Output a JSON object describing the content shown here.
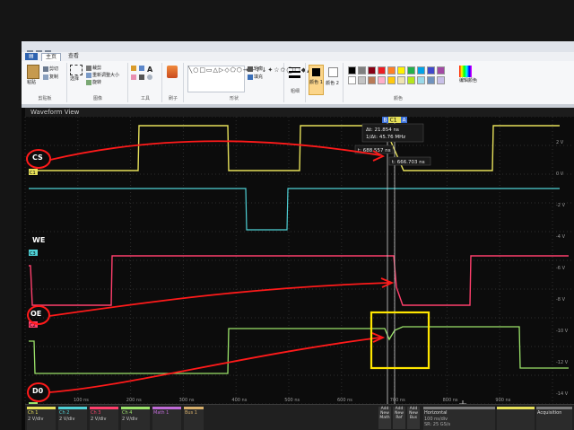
{
  "paint": {
    "tabs": [
      "主页",
      "查看"
    ],
    "clipboard": {
      "paste": "粘贴",
      "cut": "剪切",
      "copy": "复制",
      "label": "剪贴板"
    },
    "image": {
      "crop": "裁剪",
      "resize": "重新调整大小",
      "rotate": "旋转",
      "select": "选择",
      "label": "图像"
    },
    "tools": {
      "label": "工具"
    },
    "brushes": {
      "label": "刷子"
    },
    "shapes": {
      "outline": "轮廓",
      "fill": "填充",
      "label": "形状"
    },
    "size": {
      "label": "粗细"
    },
    "color1": {
      "label": "颜色 1"
    },
    "color2": {
      "label": "颜色 2"
    },
    "colors": {
      "label": "颜色",
      "edit": "编辑颜色"
    },
    "palette": [
      "#000000",
      "#7f7f7f",
      "#880015",
      "#ed1c24",
      "#ff7f27",
      "#fff200",
      "#22b14c",
      "#00a2e8",
      "#3f48cc",
      "#a349a4",
      "#ffffff",
      "#c3c3c3",
      "#b97a57",
      "#ffaec9",
      "#ffc90e",
      "#efe4b0",
      "#b5e61d",
      "#99d9ea",
      "#7092be",
      "#c8bfe7"
    ]
  },
  "scope": {
    "window_title": "Waveform View",
    "cursor_readout": {
      "delta_t": "Δt: 21.854 ns",
      "inv_delta_t": "1/Δt: 45.76 MHz",
      "t_a": "t: 688.557 ns",
      "t_b": "t: 666.703 ns"
    },
    "cursor_labels": {
      "b": "B",
      "c1": "C1",
      "a": "A"
    },
    "channel_labels": {
      "cs": "CS",
      "we": "WE",
      "oe": "OE",
      "d0": "D0"
    },
    "channel_markers": {
      "c1": "C1",
      "c2": "C2",
      "c3": "C3",
      "c4": "C4"
    },
    "right_scale": [
      "2 V",
      "0 V",
      "-2 V",
      "-4 V",
      "-6 V",
      "-8 V",
      "-10 V",
      "-12 V",
      "-14 V"
    ],
    "time_ticks": [
      "100 ns",
      "200 ns",
      "300 ns",
      "400 ns",
      "500 ns",
      "600 ns",
      "700 ns",
      "800 ns",
      "900 ns"
    ],
    "bottom_bar": {
      "ch1": {
        "name": "Ch 1",
        "scale": "2 V/div"
      },
      "ch2": {
        "name": "Ch 2",
        "scale": "2 V/div"
      },
      "ch3": {
        "name": "Ch 3",
        "scale": "2 V/div"
      },
      "ch4": {
        "name": "Ch 4",
        "scale": "2 V/div"
      },
      "math": {
        "name": "Math 1"
      },
      "bus": {
        "name": "Bus 1"
      },
      "add_math": "Add New Math",
      "add_ref": "Add New Ref",
      "add_bus": "Add New Bus",
      "horizontal": {
        "title": "Horizontal",
        "scale": "100 ns/div",
        "rate": "SR: 25 GS/s"
      },
      "acquisition": {
        "title": "Acquisition"
      }
    },
    "colors": {
      "ch1": "#e6e05a",
      "ch2": "#4fd1d6",
      "ch3": "#ff3f6c",
      "ch4": "#9be36a",
      "annot": "#ff1a1a",
      "highlight": "#ffe600"
    }
  }
}
